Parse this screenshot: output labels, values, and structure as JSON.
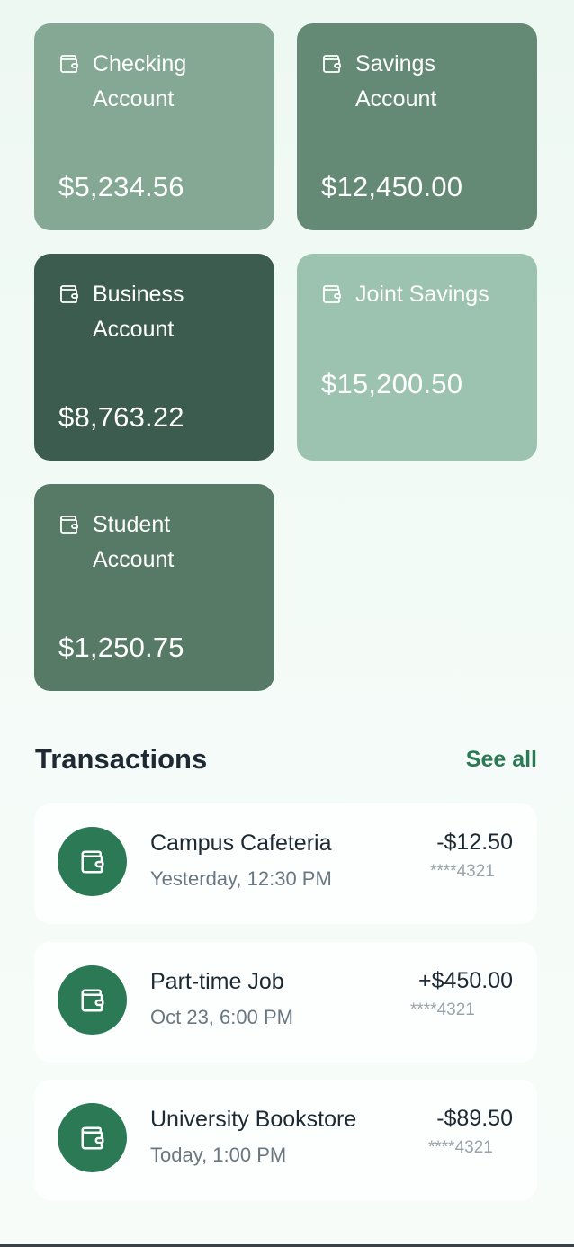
{
  "accounts": [
    {
      "name": "Checking Account",
      "balance": "$5,234.56",
      "color": "#84a894",
      "icon": "wallet-icon"
    },
    {
      "name": "Savings Account",
      "balance": "$12,450.00",
      "color": "#648a76",
      "icon": "wallet-icon"
    },
    {
      "name": "Business Account",
      "balance": "$8,763.22",
      "color": "#3b5c4e",
      "icon": "wallet-icon"
    },
    {
      "name": "Joint Savings",
      "balance": "$15,200.50",
      "color": "#9cc3b0",
      "icon": "wallet-icon"
    },
    {
      "name": "Student Account",
      "balance": "$1,250.75",
      "color": "#577a67",
      "icon": "wallet-icon"
    }
  ],
  "transactions_section": {
    "title": "Transactions",
    "see_all_label": "See all"
  },
  "transactions": [
    {
      "merchant": "Campus Cafeteria",
      "date": "Yesterday, 12:30 PM",
      "amount": "-$12.50",
      "account": "****4321",
      "icon": "wallet-icon"
    },
    {
      "merchant": "Part-time Job",
      "date": "Oct 23, 6:00 PM",
      "amount": "+$450.00",
      "account": "****4321",
      "icon": "wallet-icon"
    },
    {
      "merchant": "University Bookstore",
      "date": "Today, 1:00 PM",
      "amount": "-$89.50",
      "account": "****4321",
      "icon": "wallet-icon"
    }
  ],
  "colors": {
    "accent": "#2b7a55",
    "text_primary": "#1e2a33",
    "text_secondary": "#6b7780"
  }
}
